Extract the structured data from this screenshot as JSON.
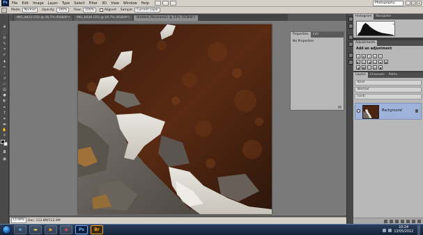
{
  "app": {
    "logo": "Ps"
  },
  "menu": [
    "File",
    "Edit",
    "Image",
    "Layer",
    "Type",
    "Select",
    "Filter",
    "3D",
    "View",
    "Window",
    "Help"
  ],
  "workspace": "Photography",
  "options": {
    "mode_label": "Mode:",
    "mode_value": "Normal",
    "opacity_label": "Opacity:",
    "opacity_value": "100%",
    "flow_label": "Flow:",
    "flow_value": "100%",
    "aligned_label": "Aligned",
    "sample_label": "Sample:",
    "sample_value": "Current Layer"
  },
  "tabs": [
    "IMG_8423.CR2 @ 16.7% (RGB/8*)",
    "IMG_8426.CR2 @ 16.7% (RGB/8*)",
    "Untitled_Panorama1 @ 14% (RGB/8*)"
  ],
  "status": {
    "zoom": "13.99%",
    "doc": "Doc: 112.8M/112.8M"
  },
  "properties": {
    "tabs": [
      "Properties",
      "Info"
    ],
    "empty_text": "No Properties"
  },
  "histogram": {
    "tabs": [
      "Histogram",
      "Navigator"
    ],
    "warning": "⚠"
  },
  "adjustments": {
    "tabs": [
      "Adjustments"
    ],
    "title": "Add an adjustment"
  },
  "layers": {
    "tabs": [
      "Layers",
      "Channels",
      "Paths"
    ],
    "kind_label": "Kind",
    "blend_mode": "Normal",
    "lock_label": "Lock:",
    "background_name": "Background"
  },
  "taskbar": {
    "time": "10:24",
    "date": "13/05/2012",
    "ps_label": "Ps",
    "br_label": "Br"
  },
  "icons": [
    "move-icon",
    "marquee-icon",
    "lasso-icon",
    "quick-select-icon",
    "crop-icon",
    "eyedropper-icon",
    "healing-icon",
    "brush-icon",
    "clone-stamp-icon",
    "history-brush-icon",
    "eraser-icon",
    "gradient-icon",
    "blur-icon",
    "dodge-icon",
    "pen-icon",
    "type-icon",
    "path-select-icon",
    "shape-icon",
    "hand-icon",
    "zoom-icon"
  ]
}
